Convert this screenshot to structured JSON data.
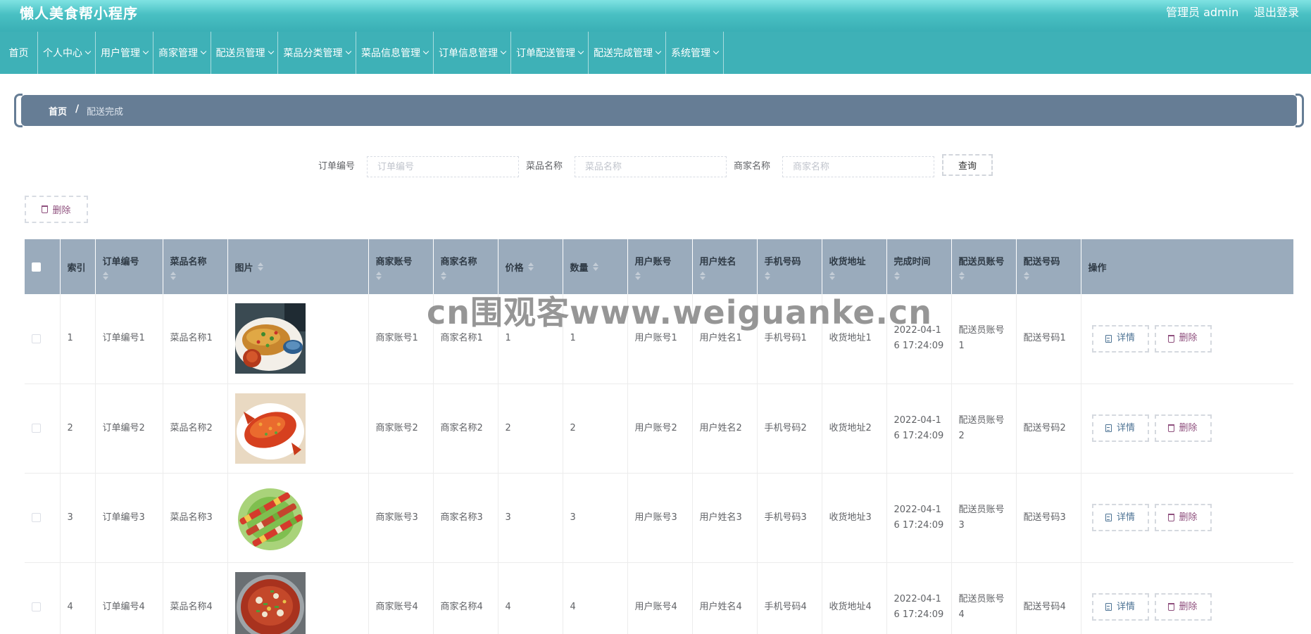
{
  "header": {
    "title": "懒人美食帮小程序",
    "admin_label": "管理员 admin",
    "logout": "退出登录"
  },
  "nav": [
    {
      "label": "首页",
      "dropdown": false
    },
    {
      "label": "个人中心",
      "dropdown": true
    },
    {
      "label": "用户管理",
      "dropdown": true
    },
    {
      "label": "商家管理",
      "dropdown": true
    },
    {
      "label": "配送员管理",
      "dropdown": true
    },
    {
      "label": "菜品分类管理",
      "dropdown": true
    },
    {
      "label": "菜品信息管理",
      "dropdown": true
    },
    {
      "label": "订单信息管理",
      "dropdown": true
    },
    {
      "label": "订单配送管理",
      "dropdown": true
    },
    {
      "label": "配送完成管理",
      "dropdown": true
    },
    {
      "label": "系统管理",
      "dropdown": true
    }
  ],
  "breadcrumb": {
    "home": "首页",
    "sep": "/",
    "current": "配送完成"
  },
  "search": {
    "order_label": "订单编号",
    "order_placeholder": "订单编号",
    "dish_label": "菜品名称",
    "dish_placeholder": "菜品名称",
    "shop_label": "商家名称",
    "shop_placeholder": "商家名称",
    "query_button": "查询"
  },
  "toolbar": {
    "delete_label": "删除"
  },
  "table": {
    "columns": [
      "索引",
      "订单编号",
      "菜品名称",
      "图片",
      "商家账号",
      "商家名称",
      "价格",
      "数量",
      "用户账号",
      "用户姓名",
      "手机号码",
      "收货地址",
      "完成时间",
      "配送员账号",
      "配送号码",
      "操作"
    ],
    "rows": [
      {
        "index": "1",
        "order_no": "订单编号1",
        "dish": "菜品名称1",
        "shop_account": "商家账号1",
        "shop_name": "商家名称1",
        "price": "1",
        "qty": "1",
        "user_account": "用户账号1",
        "user_name": "用户姓名1",
        "phone": "手机号码1",
        "address": "收货地址1",
        "finish_time": "2022-04-16 17:24:09",
        "courier_account": "配送员账号1",
        "delivery_no": "配送号码1",
        "image": "grilled-fish-dish"
      },
      {
        "index": "2",
        "order_no": "订单编号2",
        "dish": "菜品名称2",
        "shop_account": "商家账号2",
        "shop_name": "商家名称2",
        "price": "2",
        "qty": "2",
        "user_account": "用户账号2",
        "user_name": "用户姓名2",
        "phone": "手机号码2",
        "address": "收货地址2",
        "finish_time": "2022-04-16 17:24:09",
        "courier_account": "配送员账号2",
        "delivery_no": "配送号码2",
        "image": "sweet-sour-fish-dish"
      },
      {
        "index": "3",
        "order_no": "订单编号3",
        "dish": "菜品名称3",
        "shop_account": "商家账号3",
        "shop_name": "商家名称3",
        "price": "3",
        "qty": "3",
        "user_account": "用户账号3",
        "user_name": "用户姓名3",
        "phone": "手机号码3",
        "address": "收货地址3",
        "finish_time": "2022-04-16 17:24:09",
        "courier_account": "配送员账号3",
        "delivery_no": "配送号码3",
        "image": "skewers-dish"
      },
      {
        "index": "4",
        "order_no": "订单编号4",
        "dish": "菜品名称4",
        "shop_account": "商家账号4",
        "shop_name": "商家名称4",
        "price": "4",
        "qty": "4",
        "user_account": "用户账号4",
        "user_name": "用户姓名4",
        "phone": "手机号码4",
        "address": "收货地址4",
        "finish_time": "2022-04-16 17:24:09",
        "courier_account": "配送员账号4",
        "delivery_no": "配送号码4",
        "image": "spicy-pot-dish"
      }
    ],
    "actions": {
      "detail": "详情",
      "delete": "删除"
    }
  },
  "watermark": "cn围观客www.weiguanke.cn",
  "colors": {
    "header": "#3eb1b7",
    "breadcrumb": "#667d95",
    "table_header": "#9aabbc",
    "detail": "#4d7394",
    "delete": "#8e4f7d"
  }
}
